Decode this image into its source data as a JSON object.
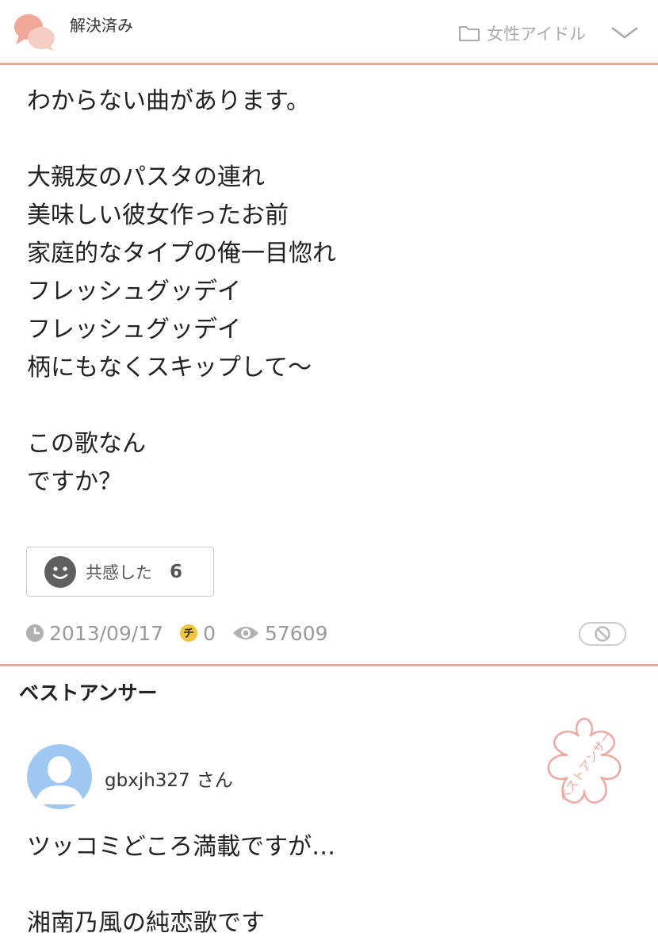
{
  "header": {
    "status": "解決済み",
    "category": "女性アイドル",
    "icons": {
      "status": "chat-bubbles-icon",
      "category": "folder-icon",
      "expand": "chevron-down-icon"
    }
  },
  "question": {
    "lines": [
      "わからない曲があります。",
      "",
      "大親友のパスタの連れ",
      "美味しい彼女作ったお前",
      "家庭的なタイプの俺一目惚れ",
      "フレッシュグッデイ",
      "フレッシュグッデイ",
      "柄にもなくスキップして〜",
      "",
      "この歌なん",
      "ですか？"
    ]
  },
  "empathy": {
    "label": "共感した",
    "count": "6"
  },
  "meta": {
    "date": "2013/09/17",
    "chiebukuro_coins": "0",
    "views": "57609"
  },
  "best_answer": {
    "title": "ベストアンサー",
    "stamp_text": "ベストアンサー",
    "user": {
      "name": "gbxjh327",
      "suffix": "さん"
    },
    "lines": [
      "ツッコミどころ満載ですが…",
      "",
      "湘南乃風の純恋歌です"
    ]
  },
  "colors": {
    "accent_rule": "#e8a898",
    "stamp": "#f0a8a0",
    "meta_gray": "#999999"
  }
}
